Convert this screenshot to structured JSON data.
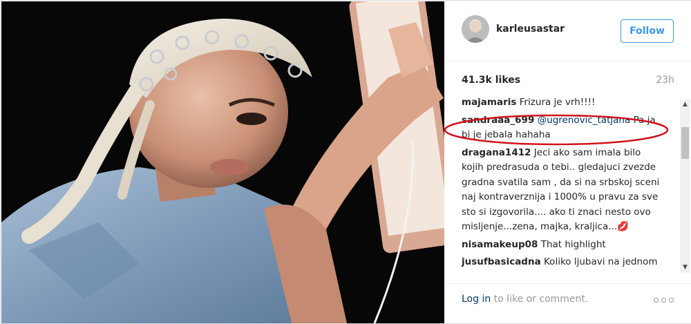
{
  "header": {
    "username": "karleusastar",
    "follow_label": "Follow"
  },
  "stats": {
    "likes": "41.3k likes",
    "time": "23h"
  },
  "comments": [
    {
      "user": "majamaris",
      "mention": "",
      "text": "Frizura je vrh!!!!"
    },
    {
      "user": "sandraaa_699",
      "mention": "@ugrenovic_tatjana",
      "text": "Pa ja bi je jebala hahaha"
    },
    {
      "user": "dragana1412",
      "mention": "",
      "text": "Jeci ako sam imala bilo kojih predrasuda o tebi.. gledajuci zvezde gradna svatila sam , da si na srbskoj sceni naj kontraverznija i 1000% u pravu za sve sto si izgovorila.... ako ti znaci nesto ovo misljenje...zena, majka, kraljica...💋"
    },
    {
      "user": "nisamakeup08",
      "mention": "",
      "text": "That highlight"
    },
    {
      "user": "jusufbasicadna",
      "mention": "",
      "text": "Koliko ljubavi na jednom mjestu"
    }
  ],
  "footer": {
    "login_label": "Log in",
    "suffix": " to like or comment."
  },
  "icons": {
    "more": "more-options-icon",
    "scroll_up": "scroll-up-icon",
    "scroll_down": "scroll-down-icon"
  },
  "colors": {
    "follow_blue": "#3897f0",
    "link_blue": "#003569",
    "annotation_red": "#d0121b"
  }
}
